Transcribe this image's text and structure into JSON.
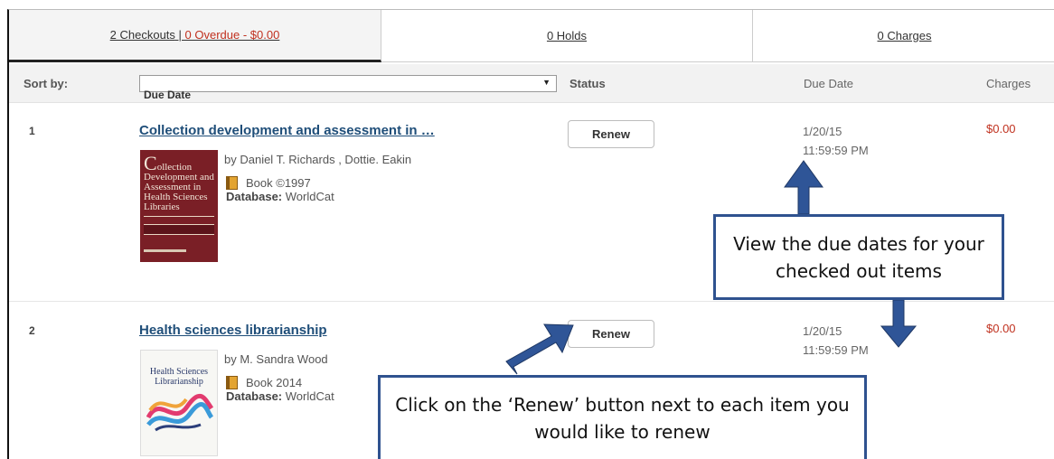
{
  "tabs": {
    "checkouts_label": "2 Checkouts",
    "separator": " | ",
    "overdue_label": "0 Overdue - $0.00",
    "holds_label": "0 Holds",
    "charges_label": "0 Charges"
  },
  "header": {
    "sort_by_label": "Sort by:",
    "sort_value": "Due Date",
    "status_label": "Status",
    "due_date_label": "Due Date",
    "charges_label": "Charges"
  },
  "items": [
    {
      "number": "1",
      "title": "Collection development and assessment in …",
      "author": "by Daniel T. Richards , Dottie. Eakin",
      "format": "Book ©1997",
      "database_label": "Database:",
      "database_value": " WorldCat",
      "renew_label": "Renew",
      "due_date": "1/20/15",
      "due_time": "11:59:59 PM",
      "charge": "$0.00",
      "cover": {
        "line1": "ollection",
        "drop_cap": "C",
        "line2": "Development and Assessment in Health Sciences Libraries",
        "color": "#7a1f26"
      }
    },
    {
      "number": "2",
      "title": "Health sciences librarianship",
      "author": "by M. Sandra Wood",
      "format": "Book 2014",
      "database_label": "Database:",
      "database_value": " WorldCat",
      "renew_label": "Renew",
      "due_date": "1/20/15",
      "due_time": "11:59:59 PM",
      "charge": "$0.00",
      "cover": {
        "title": "Health Sciences Librarianship",
        "color": "#f7f7f4"
      }
    }
  ],
  "callouts": {
    "due_dates": "View the due dates for your checked out items",
    "renew": "Click on the ‘Renew’ button next to each item you would like to renew"
  },
  "colors": {
    "link": "#1f4e79",
    "charge_red": "#c0311f",
    "callout_border": "#2f528f",
    "arrow_fill": "#2f5597"
  },
  "icons": [
    "book-icon",
    "dropdown-arrow-icon",
    "arrow-up-icon",
    "arrow-down-icon",
    "arrow-diagonal-icon"
  ]
}
